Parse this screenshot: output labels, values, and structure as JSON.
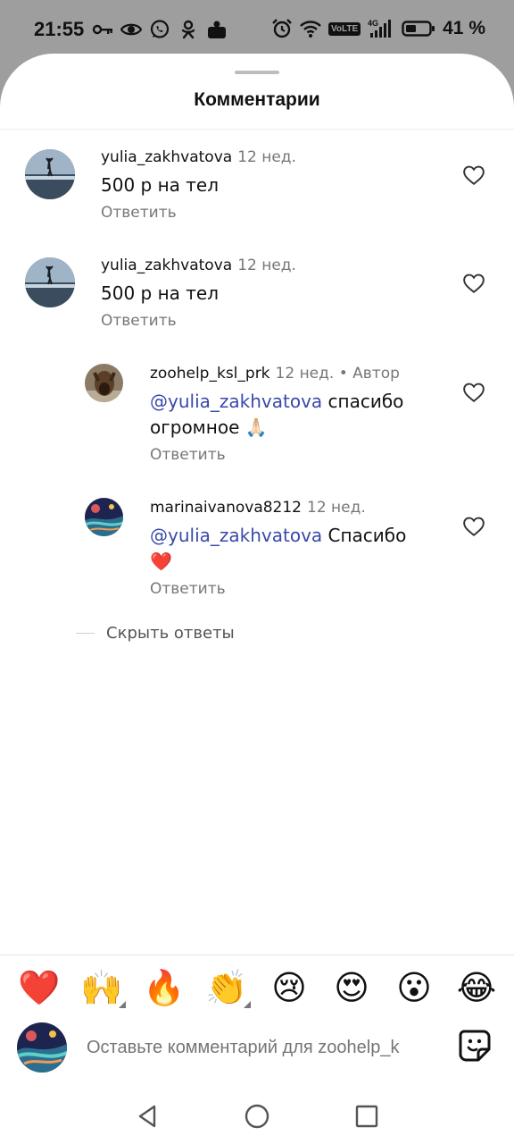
{
  "status_bar": {
    "time": "21:55",
    "battery": "41 %",
    "volte_label": "VoLTE",
    "network": "4G",
    "left_icons": [
      "key-icon",
      "eye-icon",
      "whatsapp-icon",
      "ok-icon",
      "notification-app-icon"
    ],
    "right_icons": [
      "alarm-icon",
      "wifi-icon",
      "volte-icon",
      "signal-icon",
      "battery-icon"
    ]
  },
  "sheet": {
    "title": "Комментарии"
  },
  "comments": [
    {
      "user": "yulia_zakhvatova",
      "time": "12 нед.",
      "text": "500 р на тел",
      "reply_label": "Ответить"
    },
    {
      "user": "yulia_zakhvatova",
      "time": "12 нед.",
      "text": "500 р на тел",
      "reply_label": "Ответить"
    }
  ],
  "replies": [
    {
      "user": "zoohelp_ksl_prk",
      "time": "12 нед.",
      "author_badge": "• Автор",
      "mention": "@yulia_zakhvatova",
      "text": " спасибо огромное 🙏🏻",
      "reply_label": "Ответить"
    },
    {
      "user": "marinaivanova8212",
      "time": "12 нед.",
      "mention": "@yulia_zakhvatova",
      "text": " Спасибо ❤️",
      "reply_label": "Ответить"
    }
  ],
  "hide_replies_label": "Скрыть ответы",
  "emoji_bar": [
    "❤️",
    "🙌",
    "🔥",
    "👏",
    "😢",
    "😍",
    "😮",
    "😂"
  ],
  "composer": {
    "placeholder": "Оставьте комментарий для zoohelp_k"
  },
  "colors": {
    "mention": "#3949ab",
    "secondary_text": "#777777",
    "status_bar_bg": "#9e9e9e"
  },
  "nav_bar": [
    "back-icon",
    "home-icon",
    "recents-icon"
  ]
}
